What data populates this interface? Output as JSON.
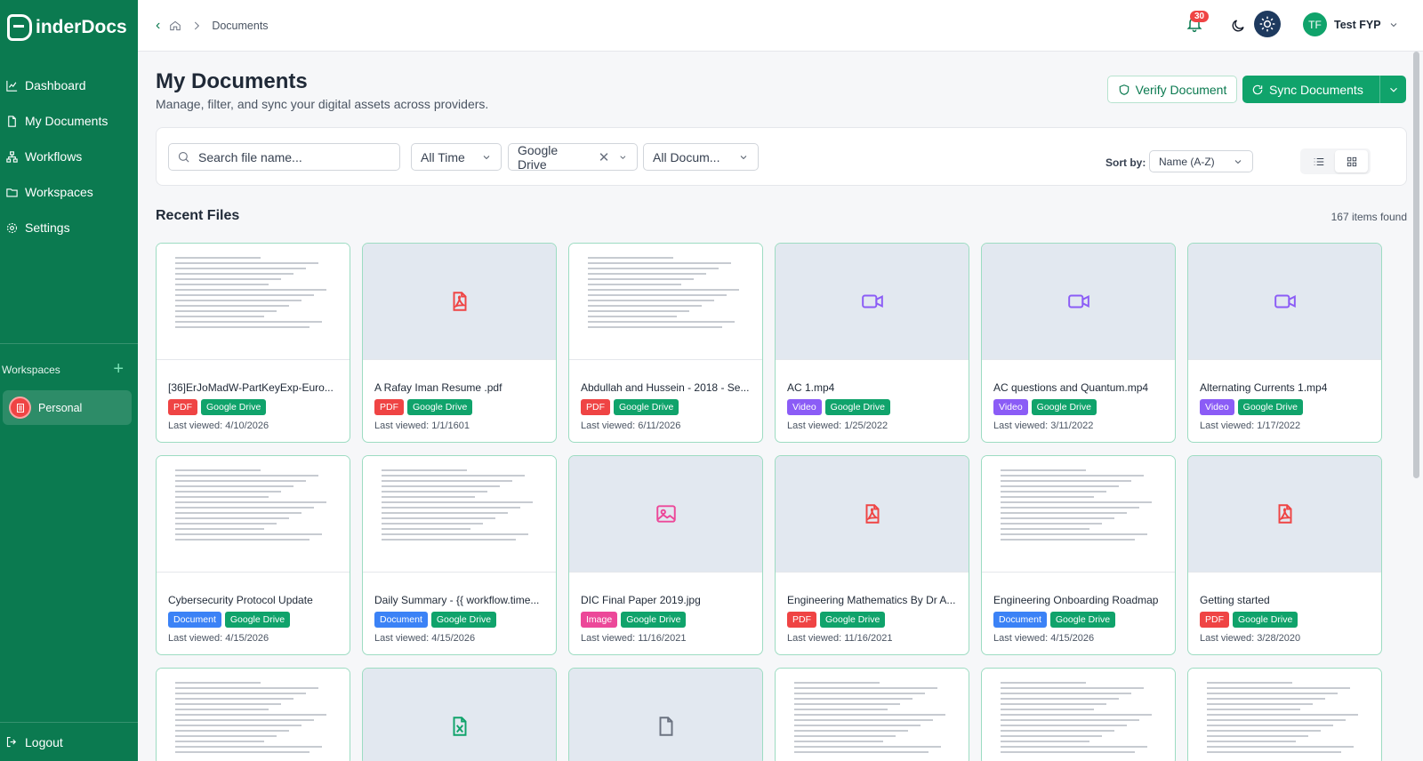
{
  "app": {
    "logo_text": "inderDocs"
  },
  "sidebar": {
    "items": [
      {
        "label": "Dashboard",
        "icon": "chart-icon"
      },
      {
        "label": "My Documents",
        "icon": "file-icon"
      },
      {
        "label": "Workflows",
        "icon": "workflow-icon"
      },
      {
        "label": "Workspaces",
        "icon": "folder-icon"
      },
      {
        "label": "Settings",
        "icon": "gear-icon"
      }
    ],
    "workspaces_label": "Workspaces",
    "workspace_item": "Personal",
    "logout": "Logout"
  },
  "topbar": {
    "breadcrumb": "Documents",
    "notifications": "30",
    "user_initials": "TF",
    "user_name": "Test FYP"
  },
  "header": {
    "title": "My Documents",
    "subtitle": "Manage, filter, and sync your digital assets across providers.",
    "verify_label": "Verify Document",
    "sync_label": "Sync Documents"
  },
  "filters": {
    "search_placeholder": "Search file name...",
    "time": "All Time",
    "provider": "Google Drive",
    "doc_type": "All Docum...",
    "sort_label": "Sort by:",
    "sort_value": "Name (A-Z)"
  },
  "section": {
    "title": "Recent Files",
    "count": "167 items found"
  },
  "colors": {
    "PDF": "#ef4444",
    "Video": "#8b5cf6",
    "Document": "#3b82f6",
    "Image": "#ec4899",
    "Google Drive": "#10a36b"
  },
  "files": [
    {
      "name": "[36]ErJoMadW-PartKeyExp-Euro...",
      "type": "PDF",
      "source": "Google Drive",
      "date": "Last viewed: 4/10/2026",
      "thumb": "paper"
    },
    {
      "name": "A Rafay Iman Resume .pdf",
      "type": "PDF",
      "source": "Google Drive",
      "date": "Last viewed: 1/1/1601",
      "thumb": "pdf-icon"
    },
    {
      "name": "Abdullah and Hussein - 2018 - Se...",
      "type": "PDF",
      "source": "Google Drive",
      "date": "Last viewed: 6/11/2026",
      "thumb": "paper"
    },
    {
      "name": "AC 1.mp4",
      "type": "Video",
      "source": "Google Drive",
      "date": "Last viewed: 1/25/2022",
      "thumb": "video-icon"
    },
    {
      "name": "AC questions and Quantum.mp4",
      "type": "Video",
      "source": "Google Drive",
      "date": "Last viewed: 3/11/2022",
      "thumb": "video-icon"
    },
    {
      "name": "Alternating Currents 1.mp4",
      "type": "Video",
      "source": "Google Drive",
      "date": "Last viewed: 1/17/2022",
      "thumb": "video-icon"
    },
    {
      "name": "Cybersecurity Protocol Update",
      "type": "Document",
      "source": "Google Drive",
      "date": "Last viewed: 4/15/2026",
      "thumb": "paper"
    },
    {
      "name": "Daily Summary - {{ workflow.time...",
      "type": "Document",
      "source": "Google Drive",
      "date": "Last viewed: 4/15/2026",
      "thumb": "paper"
    },
    {
      "name": "DIC Final Paper 2019.jpg",
      "type": "Image",
      "source": "Google Drive",
      "date": "Last viewed: 11/16/2021",
      "thumb": "image-icon"
    },
    {
      "name": "Engineering Mathematics By Dr A...",
      "type": "PDF",
      "source": "Google Drive",
      "date": "Last viewed: 11/16/2021",
      "thumb": "pdf-icon"
    },
    {
      "name": "Engineering Onboarding Roadmap",
      "type": "Document",
      "source": "Google Drive",
      "date": "Last viewed: 4/15/2026",
      "thumb": "paper"
    },
    {
      "name": "Getting started",
      "type": "PDF",
      "source": "Google Drive",
      "date": "Last viewed: 3/28/2020",
      "thumb": "pdf-icon"
    }
  ],
  "partial_row": [
    "paper",
    "sheet-icon",
    "file-icon",
    "paper",
    "paper",
    "paper"
  ]
}
